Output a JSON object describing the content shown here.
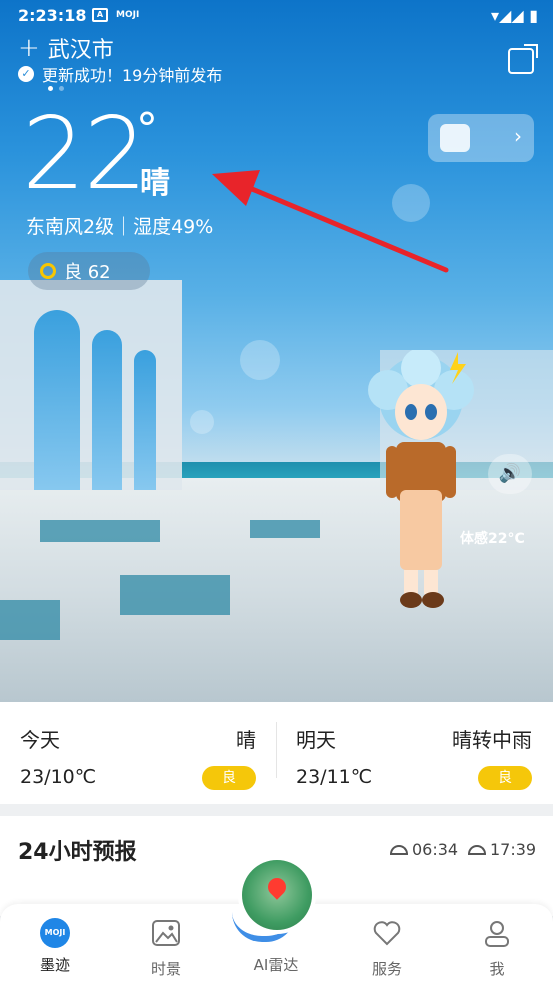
{
  "status_bar": {
    "time": "2:23:18",
    "icon_a": "A",
    "icon_moji": "MOJI"
  },
  "location": {
    "city": "武汉市",
    "update_text": "更新成功！19分钟前发布"
  },
  "current": {
    "temperature": "22",
    "degree": "°",
    "condition": "晴",
    "wind_humidity": "东南风2级｜湿度49%",
    "aqi": "良 62",
    "feels_like": "体感22°C"
  },
  "daily": [
    {
      "day": "今天",
      "weather": "晴",
      "range": "23/10℃",
      "aqi": "良"
    },
    {
      "day": "明天",
      "weather": "晴转中雨",
      "range": "23/11℃",
      "aqi": "良"
    }
  ],
  "forecast": {
    "title": "24小时预报",
    "sunrise": "06:34",
    "sunset": "17:39"
  },
  "nav": {
    "items": [
      {
        "label": "墨迹",
        "icon": "moji-icon"
      },
      {
        "label": "时景",
        "icon": "image-icon"
      },
      {
        "label": "AI雷达",
        "icon": "radar-icon"
      },
      {
        "label": "服务",
        "icon": "heart-icon"
      },
      {
        "label": "我",
        "icon": "user-icon"
      }
    ],
    "moji_text": "MOJI"
  },
  "colors": {
    "accent": "#1f86e6",
    "aqi_badge": "#f5c70a",
    "arrow": "#e8242a"
  }
}
